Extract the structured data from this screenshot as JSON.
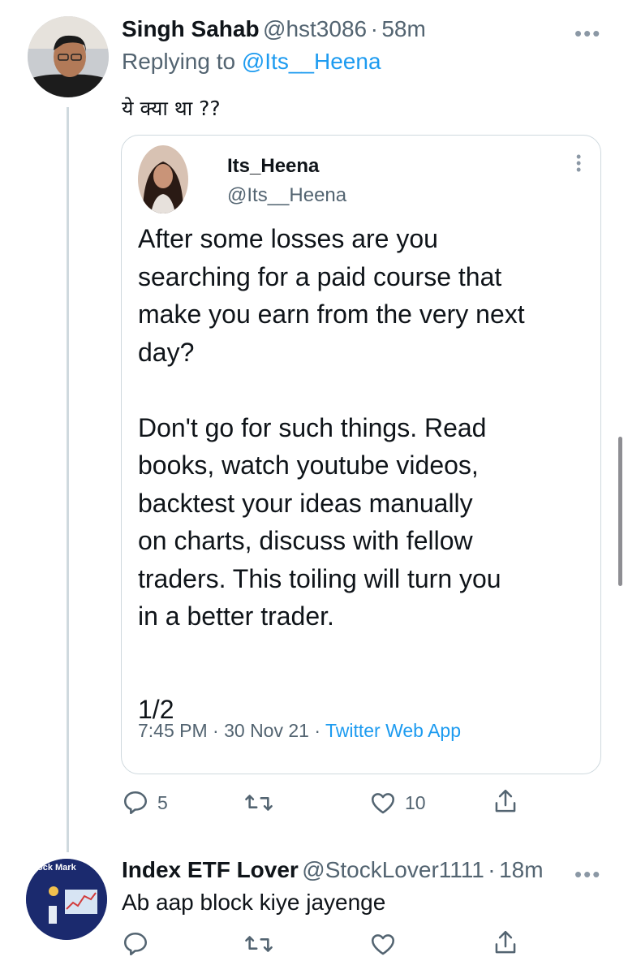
{
  "tweet1": {
    "name": "Singh Sahab",
    "handle": "@hst3086",
    "separator": "·",
    "time": "58m",
    "replying_prefix": "Replying to ",
    "replying_handle": "@Its__Heena",
    "text": "ये क्या था ??",
    "actions": {
      "reply_count": "5",
      "retweet_count": "",
      "like_count": "10"
    }
  },
  "quoted": {
    "name": "Its_Heena",
    "handle": "@Its__Heena",
    "lines": [
      "After some losses are you",
      "searching for a paid course that",
      "make you earn from the very next",
      "day?",
      "",
      "Don't go for such things. Read",
      "books, watch youtube videos,",
      "backtest your ideas manually",
      "on charts, discuss with fellow",
      "traders. This toiling will turn you",
      "in a better trader.",
      "",
      "1/2"
    ],
    "timestamp": "7:45 PM · 30 Nov 21 · ",
    "source": "Twitter Web App"
  },
  "tweet2": {
    "name": "Index ETF Lover",
    "handle": "@StockLover1111",
    "separator": "·",
    "time": "18m",
    "text": "Ab aap block kiye jayenge",
    "avatar_text": "ock Mark"
  },
  "icons": {
    "reply": "reply-icon",
    "retweet": "retweet-icon",
    "like": "heart-icon",
    "share": "share-icon",
    "more": "more-icon"
  },
  "colors": {
    "link": "#1d9bf0",
    "secondary": "#536471",
    "border": "#cfd9de"
  }
}
